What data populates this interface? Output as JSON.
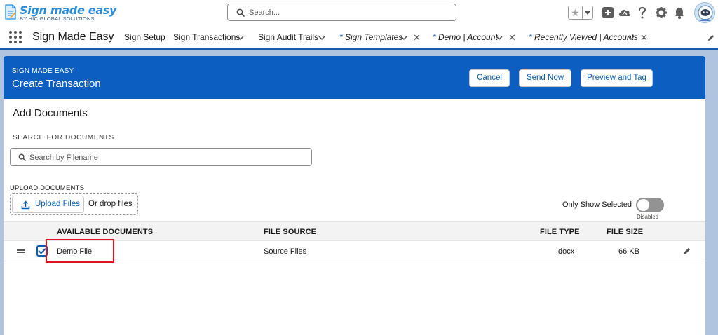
{
  "header": {
    "logo_title": "Sign made easy",
    "logo_subtitle": "BY HIC GLOBAL SOLUTIONS",
    "search_placeholder": "Search..."
  },
  "icons": {
    "favorites": "star-icon",
    "favorites_menu": "chevron-down-icon",
    "global_actions": "plus-icon",
    "trailhead": "cloud-icon",
    "help": "question-icon",
    "setup": "gear-icon",
    "notifications": "bell-icon",
    "profile": "avatar"
  },
  "nav": {
    "app_name": "Sign Made Easy",
    "items": [
      {
        "label": "Sign Setup",
        "has_dropdown": false,
        "closable": false,
        "italic": false
      },
      {
        "label": "Sign Transactions",
        "has_dropdown": true,
        "closable": false,
        "italic": false
      },
      {
        "label": "Sign Audit Trails",
        "has_dropdown": true,
        "closable": false,
        "italic": false
      },
      {
        "label": "Sign Templates",
        "has_dropdown": true,
        "closable": true,
        "italic": true,
        "prefix": "* "
      },
      {
        "label": "Demo | Account",
        "has_dropdown": true,
        "closable": true,
        "italic": true,
        "prefix": "* "
      },
      {
        "label": "Recently Viewed | Accounts",
        "has_dropdown": true,
        "closable": true,
        "italic": true,
        "prefix": "* "
      }
    ]
  },
  "card": {
    "subtitle": "SIGN MADE EASY",
    "title": "Create Transaction",
    "buttons": {
      "cancel": "Cancel",
      "send_now": "Send Now",
      "preview_and_tag": "Preview and Tag"
    }
  },
  "documents": {
    "section_title": "Add Documents",
    "search_label": "SEARCH FOR DOCUMENTS",
    "search_placeholder": "Search by Filename",
    "upload_label": "UPLOAD DOCUMENTS",
    "upload_button": "Upload Files",
    "drop_text": "Or drop files",
    "toggle_label": "Only Show Selected",
    "toggle_state": "Disabled",
    "toggle_on": false
  },
  "table": {
    "columns": [
      "AVAILABLE DOCUMENTS",
      "FILE SOURCE",
      "FILE TYPE",
      "FILE SIZE"
    ],
    "rows": [
      {
        "name": "Demo File",
        "source": "Source Files",
        "type": "docx",
        "size": "66 KB",
        "selected": true
      }
    ]
  },
  "colors": {
    "brand_blue": "#0c5ec0",
    "link_blue": "#0b5cab",
    "background": "#b0c4df",
    "highlight_red": "#e0141e"
  }
}
